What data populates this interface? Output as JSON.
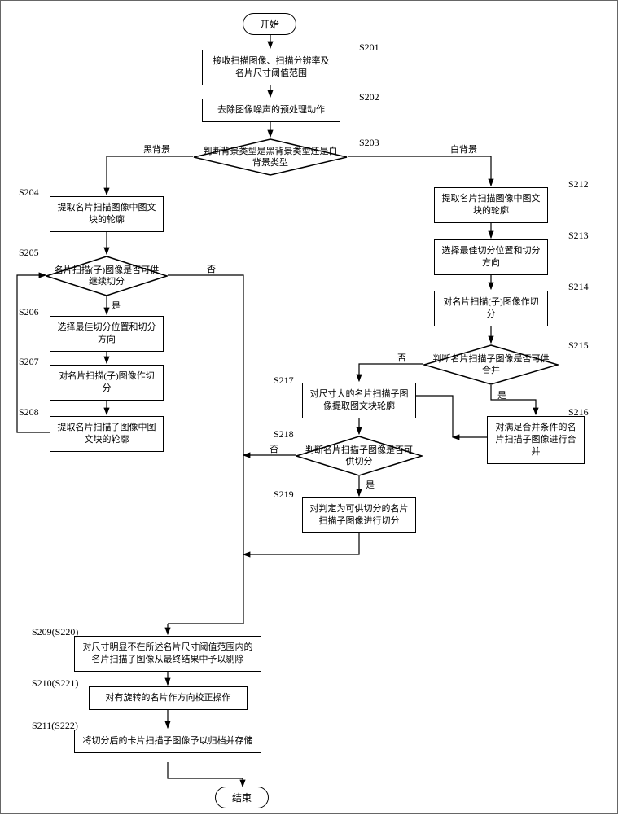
{
  "terminators": {
    "start": "开始",
    "end": "结束"
  },
  "steps": {
    "s201": "接收扫描图像、扫描分辨率及名片尺寸阈值范围",
    "s202": "去除图像噪声的预处理动作",
    "s203": "判断背景类型是黑背景类型还是白背景类型",
    "s204": "提取名片扫描图像中图文块的轮廓",
    "s205": "名片扫描(子)图像是否可供继续切分",
    "s206": "选择最佳切分位置和切分方向",
    "s207": "对名片扫描(子)图像作切分",
    "s208": "提取名片扫描子图像中图文块的轮廓",
    "s209": "对尺寸明显不在所述名片尺寸阈值范围内的名片扫描子图像从最终结果中予以剔除",
    "s210": "对有旋转的名片作方向校正操作",
    "s211": "将切分后的卡片扫描子图像予以归档并存储",
    "s212": "提取名片扫描图像中图文块的轮廓",
    "s213": "选择最佳切分位置和切分方向",
    "s214": "对名片扫描(子)图像作切分",
    "s215": "判断名片扫描子图像是否可供合并",
    "s216": "对满足合并条件的名片扫描子图像进行合并",
    "s217": "对尺寸大的名片扫描子图像提取图文块轮廓",
    "s218": "判断名片扫描子图像是否可供切分",
    "s219": "对判定为可供切分的名片扫描子图像进行切分"
  },
  "labels": {
    "s201": "S201",
    "s202": "S202",
    "s203": "S203",
    "s204": "S204",
    "s205": "S205",
    "s206": "S206",
    "s207": "S207",
    "s208": "S208",
    "s209": "S209(S220)",
    "s210": "S210(S221)",
    "s211": "S211(S222)",
    "s212": "S212",
    "s213": "S213",
    "s214": "S214",
    "s215": "S215",
    "s216": "S216",
    "s217": "S217",
    "s218": "S218",
    "s219": "S219"
  },
  "edgeLabels": {
    "black": "黑背景",
    "white": "白背景",
    "yes": "是",
    "no": "否"
  }
}
